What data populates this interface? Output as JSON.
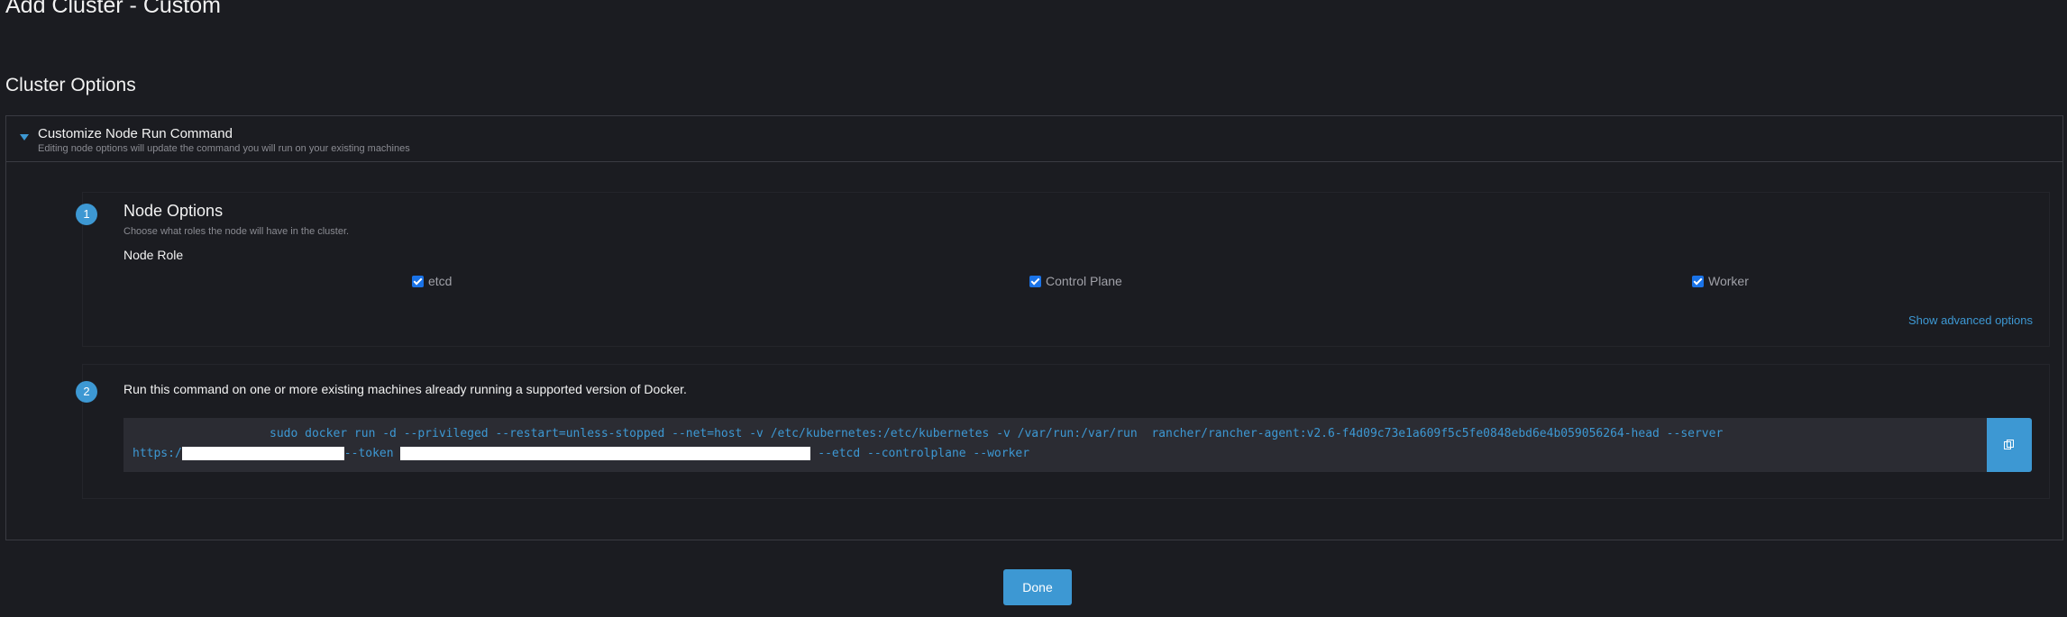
{
  "page": {
    "title": "Add Cluster - Custom"
  },
  "cluster_options": {
    "title": "Cluster Options"
  },
  "customize": {
    "title": "Customize Node Run Command",
    "subtitle": "Editing node options will update the command you will run on your existing machines"
  },
  "step1": {
    "number": "1",
    "title": "Node Options",
    "subtitle": "Choose what roles the node will have in the cluster.",
    "role_label": "Node Role",
    "roles": [
      {
        "label": "etcd",
        "checked": true
      },
      {
        "label": "Control Plane",
        "checked": true
      },
      {
        "label": "Worker",
        "checked": true
      }
    ],
    "advanced_link": "Show advanced options"
  },
  "step2": {
    "number": "2",
    "text": "Run this command on one or more existing machines already running a supported version of Docker.",
    "command_line1": "sudo docker run -d --privileged --restart=unless-stopped --net=host -v /etc/kubernetes:/etc/kubernetes -v /var/run:/var/run  rancher/rancher-agent:v2.6-f4d09c73e1a609f5c5fe0848ebd6e4b059056264-head --server",
    "command_prefix": "https:/",
    "command_token_flag": "--token ",
    "command_suffix": " --etcd --controlplane --worker"
  },
  "actions": {
    "done_label": "Done"
  },
  "colors": {
    "background": "#1b1c21",
    "accent": "#3d98d3",
    "code_background": "#2b2c33",
    "checkbox": "#1a73e8"
  },
  "icons": {
    "caret": "caret-down-icon",
    "copy": "copy-icon",
    "check": "check-icon"
  }
}
